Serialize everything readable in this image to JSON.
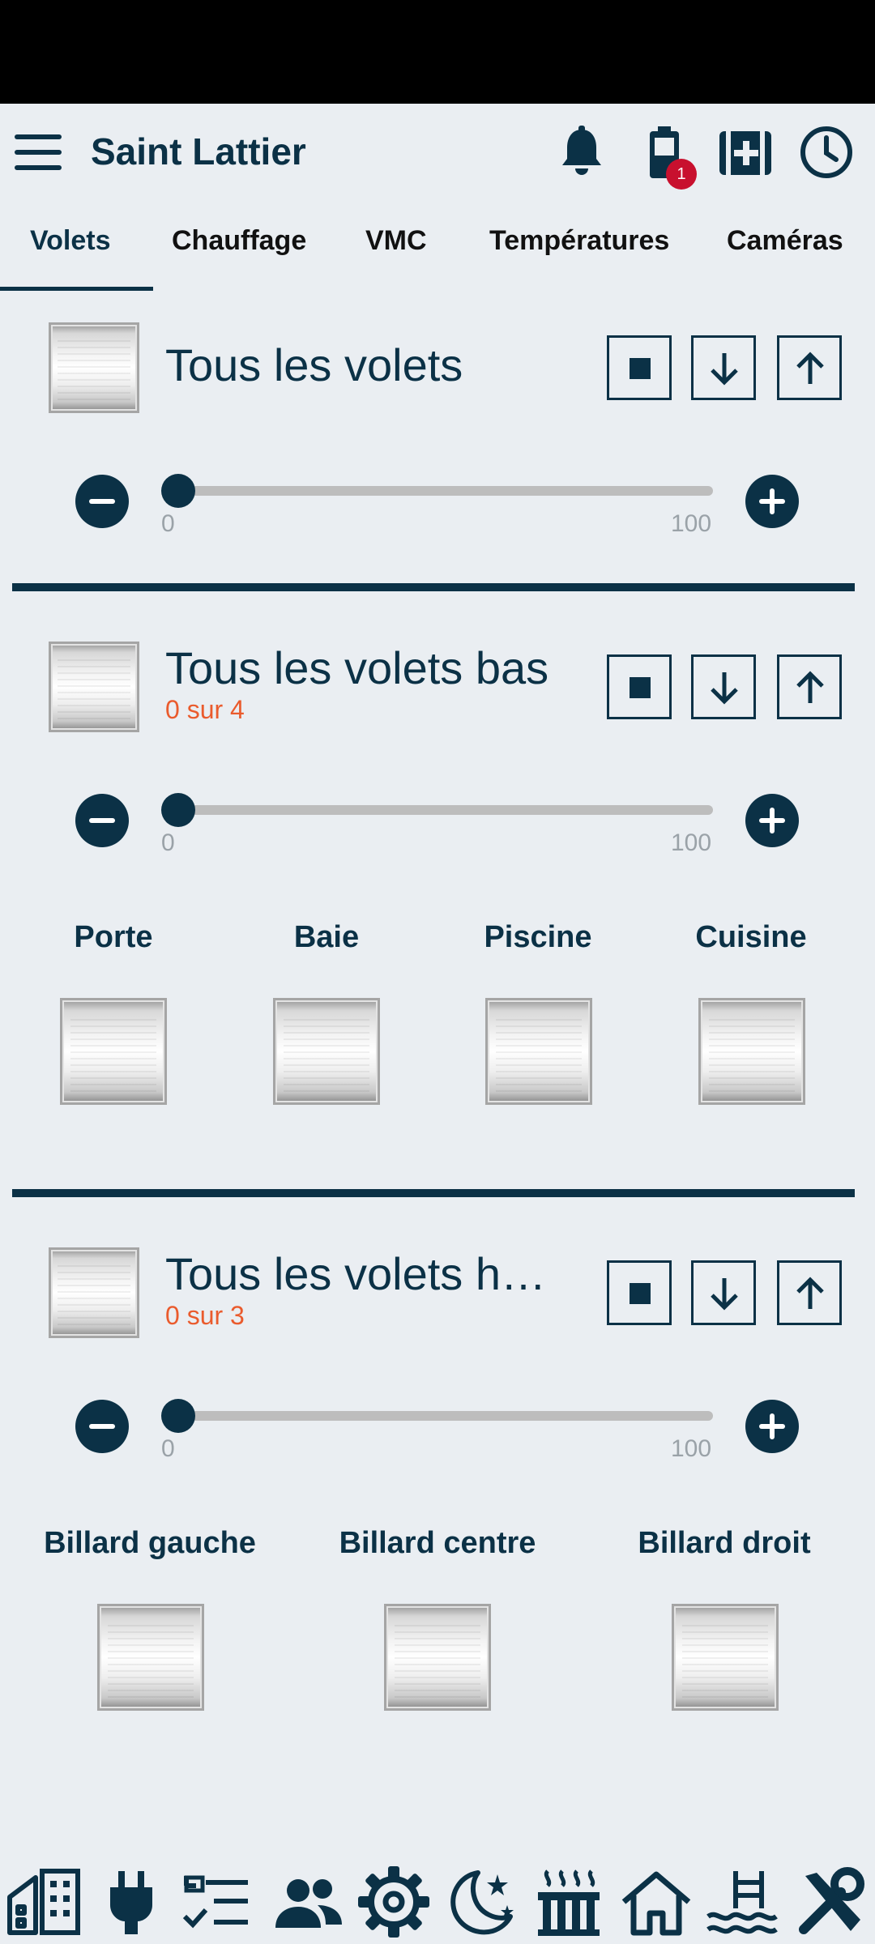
{
  "app": {
    "title": "Saint Lattier",
    "notification_badge": "1"
  },
  "tabs": [
    {
      "label": "Volets",
      "active": true
    },
    {
      "label": "Chauffage"
    },
    {
      "label": "VMC"
    },
    {
      "label": "Températures"
    },
    {
      "label": "Caméras"
    }
  ],
  "groups": [
    {
      "title": "Tous les volets",
      "subtitle": "",
      "slider": {
        "value": 0,
        "min_label": "0",
        "max_label": "100"
      }
    },
    {
      "title": "Tous les volets bas",
      "subtitle": "0 sur 4",
      "slider": {
        "value": 0,
        "min_label": "0",
        "max_label": "100"
      },
      "items": [
        "Porte",
        "Baie",
        "Piscine",
        "Cuisine"
      ]
    },
    {
      "title": "Tous les volets ha...",
      "subtitle": "0 sur 3",
      "slider": {
        "value": 0,
        "min_label": "0",
        "max_label": "100"
      },
      "items": [
        "Billard gauche",
        "Billard centre",
        "Billard droit"
      ]
    }
  ],
  "colors": {
    "primary": "#0b3146",
    "accent": "#ea5b2d",
    "badge": "#c8102e",
    "background": "#eaeef2"
  },
  "bottom_nav_icons": [
    "building-icon",
    "plug-icon",
    "checklist-icon",
    "people-icon",
    "gear-icon",
    "night-icon",
    "heater-icon",
    "home-icon",
    "pool-icon",
    "tools-icon"
  ]
}
